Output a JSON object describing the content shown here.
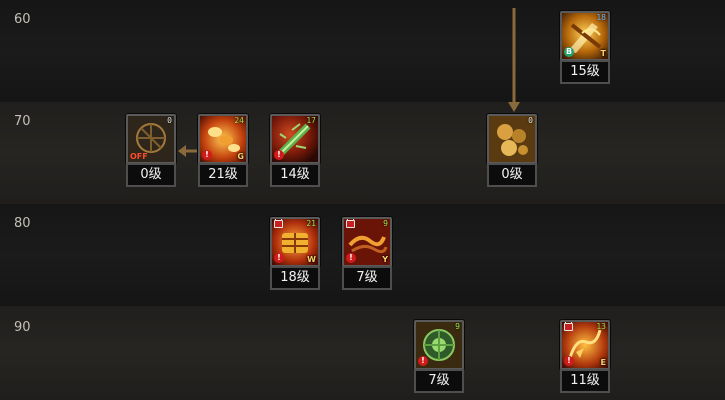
{
  "rows": [
    {
      "label": "60"
    },
    {
      "label": "70"
    },
    {
      "label": "80"
    },
    {
      "label": "90"
    }
  ],
  "skills": [
    {
      "id": "s60a",
      "level_text": "15级",
      "req_level": "18",
      "req_color": "blue",
      "key": "T",
      "icon": "golden-cross-slash-icon",
      "badge": "B",
      "badge_type": "green",
      "locked": false,
      "off": false
    },
    {
      "id": "s70a",
      "level_text": "0级",
      "req_level": "0",
      "req_color": "",
      "key": "",
      "icon": "rune-circle-icon",
      "badge": "",
      "locked": false,
      "off": true,
      "off_text": "OFF"
    },
    {
      "id": "s70b",
      "level_text": "21级",
      "req_level": "24",
      "req_color": "green",
      "key": "G",
      "icon": "chain-strike-icon",
      "badge": "!",
      "badge_type": "red",
      "locked": false,
      "off": false
    },
    {
      "id": "s70c",
      "level_text": "14级",
      "req_level": "17",
      "req_color": "green",
      "key": "",
      "icon": "green-bamboo-icon",
      "badge": "!",
      "badge_type": "red",
      "locked": false,
      "off": false
    },
    {
      "id": "s70d",
      "level_text": "0级",
      "req_level": "0",
      "req_color": "",
      "key": "",
      "icon": "gear-cluster-icon",
      "badge": "",
      "locked": false,
      "off": false
    },
    {
      "id": "s80a",
      "level_text": "18级",
      "req_level": "21",
      "req_color": "green",
      "key": "W",
      "icon": "chest-armor-icon",
      "badge": "!",
      "badge_type": "red",
      "locked": true,
      "off": false
    },
    {
      "id": "s80b",
      "level_text": "7级",
      "req_level": "9",
      "req_color": "green",
      "key": "Y",
      "icon": "dragon-slash-icon",
      "badge": "!",
      "badge_type": "red",
      "locked": true,
      "off": false
    },
    {
      "id": "s90a",
      "level_text": "7级",
      "req_level": "9",
      "req_color": "green",
      "key": "",
      "icon": "jade-seal-icon",
      "badge": "!",
      "badge_type": "red",
      "locked": false,
      "off": false
    },
    {
      "id": "s90b",
      "level_text": "11级",
      "req_level": "13",
      "req_color": "green",
      "key": "E",
      "icon": "flame-dragon-icon",
      "badge": "!",
      "badge_type": "red",
      "locked": true,
      "off": false
    }
  ],
  "colors": {
    "arrow": "#8a6a3a",
    "icon_gold": "#e8a21c",
    "icon_red": "#8c1a10",
    "icon_green": "#3f8a2a"
  }
}
